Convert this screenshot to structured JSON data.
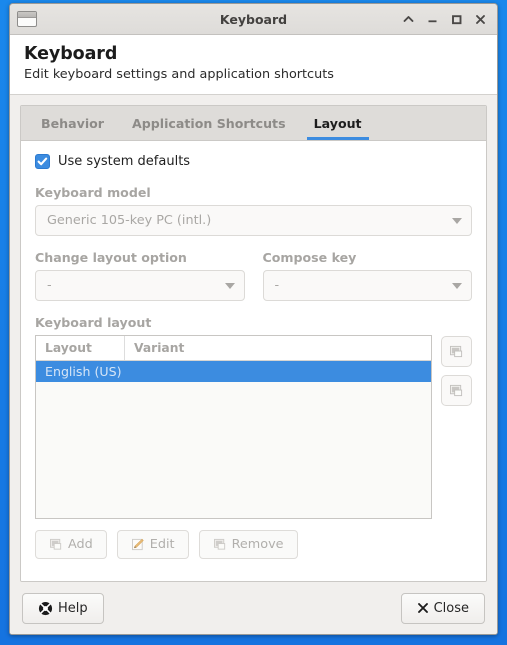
{
  "window": {
    "title": "Keyboard",
    "menu_icon": "window-menu-icon",
    "buttons": [
      {
        "name": "shade",
        "icon": "chevron-up-icon"
      },
      {
        "name": "minimize",
        "icon": "minimize-icon"
      },
      {
        "name": "maximize",
        "icon": "maximize-icon"
      },
      {
        "name": "close",
        "icon": "close-icon"
      }
    ]
  },
  "header": {
    "title": "Keyboard",
    "subtitle": "Edit keyboard settings and application shortcuts"
  },
  "tabs": [
    {
      "label": "Behavior",
      "active": false
    },
    {
      "label": "Application Shortcuts",
      "active": false
    },
    {
      "label": "Layout",
      "active": true
    }
  ],
  "layout_tab": {
    "use_system_defaults": {
      "label": "Use system defaults",
      "checked": true
    },
    "keyboard_model": {
      "label": "Keyboard model",
      "value": "Generic 105-key PC (intl.)"
    },
    "change_layout_option": {
      "label": "Change layout option",
      "value": "-"
    },
    "compose_key": {
      "label": "Compose key",
      "value": "-"
    },
    "keyboard_layout": {
      "label": "Keyboard layout",
      "columns": [
        "Layout",
        "Variant"
      ],
      "rows": [
        {
          "layout": "English (US)",
          "variant": "",
          "selected": true
        }
      ]
    },
    "side_buttons": [
      {
        "name": "move-up-button",
        "icon": "document-icon"
      },
      {
        "name": "move-down-button",
        "icon": "document-icon"
      }
    ],
    "action_buttons": [
      {
        "name": "add-button",
        "label": "Add",
        "icon": "document-icon"
      },
      {
        "name": "edit-button",
        "label": "Edit",
        "icon": "pencil-icon"
      },
      {
        "name": "remove-button",
        "label": "Remove",
        "icon": "document-icon"
      }
    ]
  },
  "footer": {
    "help": {
      "label": "Help",
      "icon": "lifebuoy-icon"
    },
    "close": {
      "label": "Close",
      "icon": "close-x-icon"
    }
  },
  "colors": {
    "desktop": "#1a88ec",
    "accent": "#3c8ce0",
    "selection": "#3c8ce0",
    "window_bg": "#f1efed",
    "disabled_text": "#a9a7a4"
  }
}
